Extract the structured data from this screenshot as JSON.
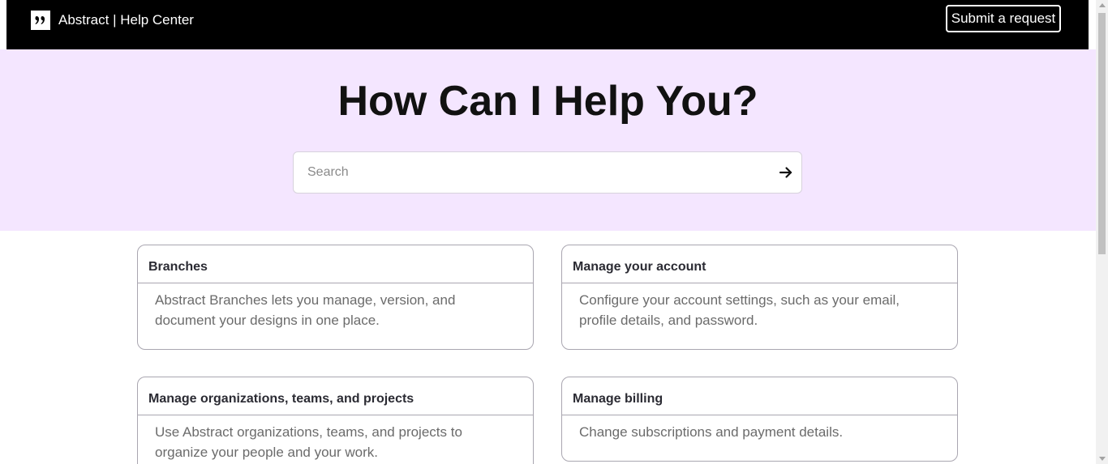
{
  "header": {
    "brand_icon": "abstract-logo-icon",
    "title": "Abstract | Help Center",
    "submit_label": "Submit a request"
  },
  "hero": {
    "title": "How Can I Help You?",
    "search": {
      "placeholder": "Search",
      "value": "",
      "submit_icon": "arrow-right-icon"
    }
  },
  "cards": [
    {
      "title": "Branches",
      "description": "Abstract Branches lets you manage, version, and document your designs in one place."
    },
    {
      "title": "Manage your account",
      "description": "Configure your account settings, such as your email, profile details, and password."
    },
    {
      "title": "Manage organizations, teams, and projects",
      "description": "Use Abstract organizations, teams, and projects to organize your people and your work."
    },
    {
      "title": "Manage billing",
      "description": "Change subscriptions and payment details."
    }
  ],
  "colors": {
    "header_bg": "#000000",
    "hero_bg": "#f4e6ff",
    "card_border": "#a9a6b0"
  }
}
